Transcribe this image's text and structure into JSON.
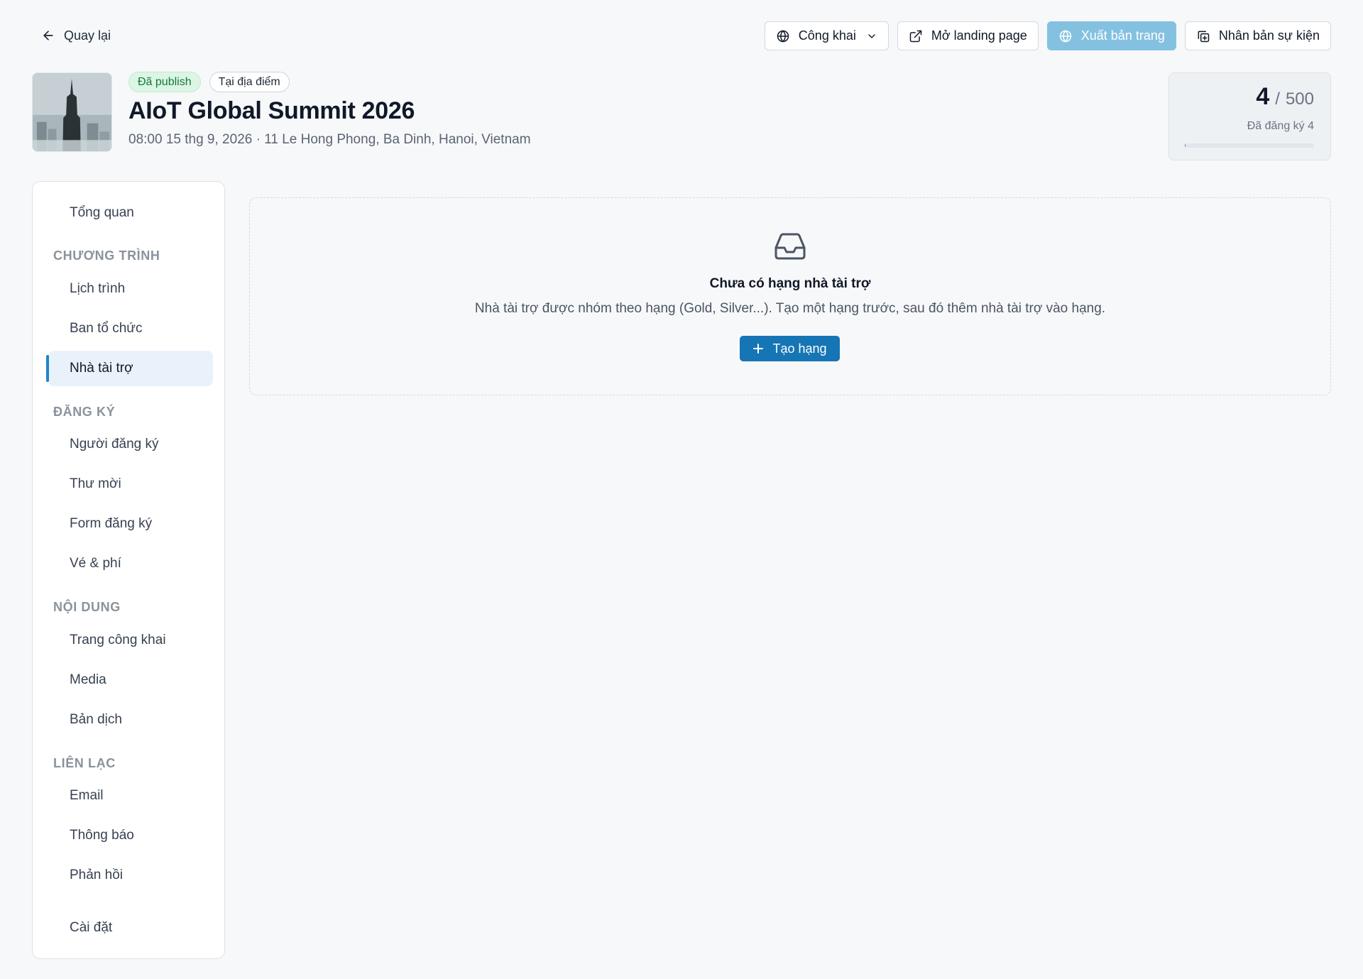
{
  "topbar": {
    "back_label": "Quay lại",
    "visibility_label": "Công khai",
    "open_landing_label": "Mở landing page",
    "publish_label": "Xuất bản trang",
    "duplicate_label": "Nhân bản sự kiện"
  },
  "event": {
    "status_badge": "Đã publish",
    "type_badge": "Tại địa điểm",
    "title": "AIoT Global Summit 2026",
    "meta": "08:00 15 thg 9, 2026 · 11 Le Hong Phong, Ba Dinh, Hanoi, Vietnam"
  },
  "registration": {
    "count": "4",
    "separator": "/",
    "capacity": "500",
    "label": "Đã đăng ký 4",
    "progress_fraction": 0.008
  },
  "sidebar": {
    "overview": "Tổng quan",
    "sections": {
      "program": "CHƯƠNG TRÌNH",
      "registration": "ĐĂNG KÝ",
      "content": "NỘI DUNG",
      "contact": "LIÊN LẠC"
    },
    "items": {
      "schedule": "Lịch trình",
      "organizers": "Ban tổ chức",
      "sponsors": "Nhà tài trợ",
      "registrants": "Người đăng ký",
      "invitations": "Thư mời",
      "form": "Form đăng ký",
      "tickets": "Vé & phí",
      "public_page": "Trang công khai",
      "media": "Media",
      "translations": "Bản dịch",
      "email": "Email",
      "notifications": "Thông báo",
      "feedback": "Phản hồi",
      "settings": "Cài đặt"
    },
    "active_item": "sponsors"
  },
  "empty_state": {
    "icon": "inbox-icon",
    "title": "Chưa có hạng nhà tài trợ",
    "description": "Nhà tài trợ được nhóm theo hạng (Gold, Silver...). Tạo một hạng trước, sau đó thêm nhà tài trợ vào hạng.",
    "create_label": "Tạo hạng"
  },
  "colors": {
    "accent": "#1675b5",
    "publish_disabled": "#84c1e0",
    "status_green": "#137a3c"
  }
}
